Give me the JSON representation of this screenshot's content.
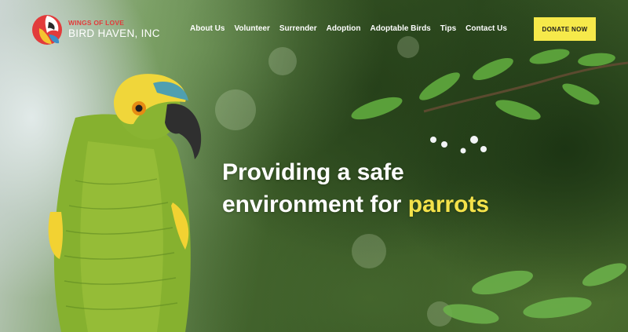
{
  "brand": {
    "line1": "WINGS OF LOVE",
    "line2": "BIRD HAVEN, INC",
    "accent_color": "#e23b3b"
  },
  "nav": {
    "items": [
      {
        "label": "About Us"
      },
      {
        "label": "Volunteer"
      },
      {
        "label": "Surrender"
      },
      {
        "label": "Adoption"
      },
      {
        "label": "Adoptable Birds"
      },
      {
        "label": "Tips"
      },
      {
        "label": "Contact Us"
      }
    ]
  },
  "cta": {
    "label": "DONATE NOW",
    "color": "#f6e94a"
  },
  "hero": {
    "headline_line1": "Providing a safe",
    "headline_line2_start": "environment for ",
    "headline_accent": "parrots",
    "accent_color": "#f4e24a",
    "image": "green-parrot-on-perch-with-leafy-branches"
  }
}
